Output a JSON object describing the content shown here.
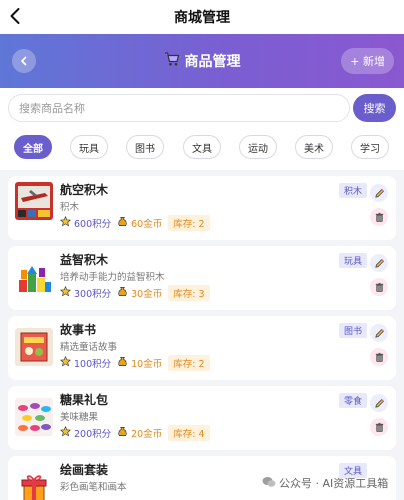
{
  "topbar": {
    "title": "商城管理"
  },
  "header": {
    "title": "商品管理",
    "add_label": "+ 新增"
  },
  "search": {
    "placeholder": "搜索商品名称",
    "button_label": "搜索"
  },
  "categories": [
    "全部",
    "玩具",
    "图书",
    "文具",
    "运动",
    "美术",
    "学习"
  ],
  "active_category": "全部",
  "products": [
    {
      "name": "航空积木",
      "desc": "积木",
      "points": "600积分",
      "coins": "60金币",
      "stock": "库存: 2",
      "tag": "积木"
    },
    {
      "name": "益智积木",
      "desc": "培养动手能力的益智积木",
      "points": "300积分",
      "coins": "30金币",
      "stock": "库存: 3",
      "tag": "玩具"
    },
    {
      "name": "故事书",
      "desc": "精选童话故事",
      "points": "100积分",
      "coins": "10金币",
      "stock": "库存: 2",
      "tag": "图书"
    },
    {
      "name": "糖果礼包",
      "desc": "美味糖果",
      "points": "200积分",
      "coins": "20金币",
      "stock": "库存: 4",
      "tag": "零食"
    },
    {
      "name": "绘画套装",
      "desc": "彩色画笔和画本",
      "points": "",
      "coins": "",
      "stock": "",
      "tag": "文具"
    }
  ],
  "watermark": "公众号 · AI资源工具箱",
  "colors": {
    "accent": "#6a5dcc",
    "points": "#5b55c8",
    "coins": "#e08a1e"
  }
}
